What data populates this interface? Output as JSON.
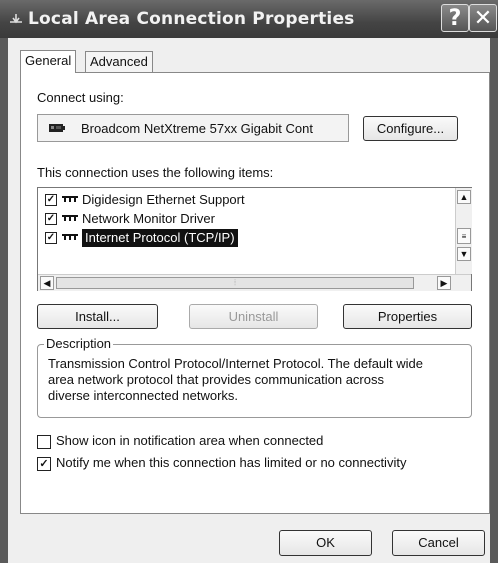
{
  "window": {
    "title": "Local Area Connection Properties",
    "help_glyph": "?",
    "close_glyph": "✕"
  },
  "tabs": [
    {
      "label": "General"
    },
    {
      "label": "Advanced"
    }
  ],
  "connect": {
    "label": "Connect using:",
    "adapter": "Broadcom NetXtreme 57xx Gigabit Cont",
    "configure_label": "Configure..."
  },
  "items_section": {
    "label": "This connection uses the following items:",
    "items": [
      {
        "label": "Digidesign Ethernet Support",
        "checked": true
      },
      {
        "label": "Network Monitor Driver",
        "checked": true
      },
      {
        "label": "Internet Protocol (TCP/IP)",
        "checked": true,
        "selected": true
      }
    ]
  },
  "buttons": {
    "install": "Install...",
    "uninstall": "Uninstall",
    "properties": "Properties"
  },
  "description": {
    "legend": "Description",
    "lines": [
      "Transmission Control Protocol/Internet Protocol. The default wide",
      "area network protocol that provides communication across",
      "diverse interconnected networks."
    ]
  },
  "options": [
    {
      "label": "Show icon in notification area when connected",
      "checked": false
    },
    {
      "label": "Notify me when this connection has limited or no connectivity",
      "checked": true
    }
  ],
  "footer": {
    "ok": "OK",
    "cancel": "Cancel"
  },
  "icons": {
    "title": "network-icon",
    "adapter": "network-card-icon",
    "item": "network-protocol-icon"
  }
}
